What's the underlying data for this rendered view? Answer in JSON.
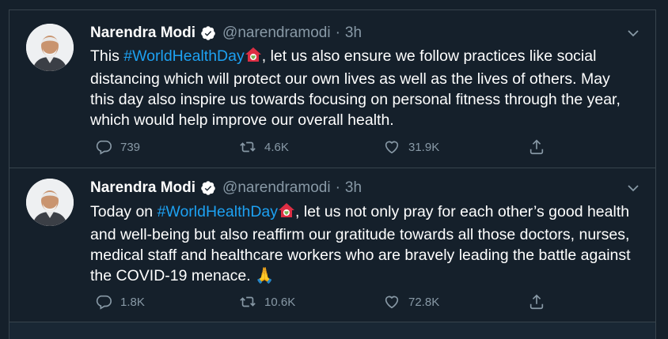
{
  "tweets": [
    {
      "author_name": "Narendra Modi",
      "handle": "@narendramodi",
      "separator": "·",
      "time": "3h",
      "text_before": "This ",
      "hashtag": "#WorldHealthDay",
      "text_after": ", let us also ensure we follow practices like social distancing which will protect our own lives as well as the lives of others. May this day also inspire us towards focusing on personal fitness through the year, which would help improve our overall health.",
      "end_emoji": "",
      "replies": "739",
      "retweets": "4.6K",
      "likes": "31.9K"
    },
    {
      "author_name": "Narendra Modi",
      "handle": "@narendramodi",
      "separator": "·",
      "time": "3h",
      "text_before": "Today on ",
      "hashtag": "#WorldHealthDay",
      "text_after": ", let us not only pray for each other’s good health and well-being but also reaffirm our gratitude towards all those doctors, nurses, medical staff and healthcare workers who are bravely leading the battle against the COVID-19 menace. ",
      "end_emoji": "🙏",
      "replies": "1.8K",
      "retweets": "10.6K",
      "likes": "72.8K"
    }
  ],
  "colors": {
    "background": "#15202b",
    "border": "#38444d",
    "muted": "#8899a6",
    "link": "#1da1f2",
    "verified": "#ffffff"
  },
  "icons": [
    "verified-badge-icon",
    "chevron-down-icon",
    "reply-icon",
    "retweet-icon",
    "like-icon",
    "share-icon",
    "health-house-emoji-icon"
  ]
}
